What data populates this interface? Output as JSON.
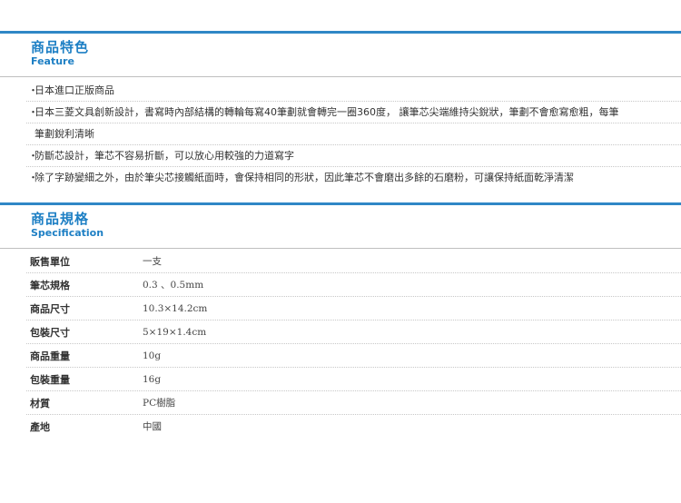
{
  "feature": {
    "title_zh": "商品特色",
    "title_en": "Feature",
    "bullet": "・",
    "items": [
      {
        "lines": [
          "日本進口正版商品"
        ]
      },
      {
        "lines": [
          "日本三菱文具創新設計，書寫時內部結構的轉輪每寫40筆劃就會轉完一圈360度， 讓筆芯尖端維持尖銳狀，筆劃不會愈寫愈粗，每筆",
          "筆劃銳利清晰"
        ]
      },
      {
        "lines": [
          "防斷芯設計，筆芯不容易折斷，可以放心用較強的力道寫字"
        ]
      },
      {
        "lines": [
          "除了字跡變細之外，由於筆尖芯接觸紙面時，會保持相同的形狀，因此筆芯不會磨出多餘的石磨粉，可讓保持紙面乾淨清潔"
        ]
      }
    ]
  },
  "spec": {
    "title_zh": "商品規格",
    "title_en": "Specification",
    "rows": [
      {
        "label": "販售單位",
        "value": "一支"
      },
      {
        "label": "筆芯規格",
        "value": "0.3 、0.5mm"
      },
      {
        "label": "商品尺寸",
        "value": "10.3×14.2cm"
      },
      {
        "label": "包裝尺寸",
        "value": "5×19×1.4cm"
      },
      {
        "label": "商品重量",
        "value": "10g"
      },
      {
        "label": "包裝重量",
        "value": "16g"
      },
      {
        "label": "材質",
        "value": "PC樹脂"
      },
      {
        "label": "產地",
        "value": "中國"
      }
    ]
  },
  "colors": {
    "accent": "#1d7fc4",
    "bar": "#2f87c6"
  }
}
